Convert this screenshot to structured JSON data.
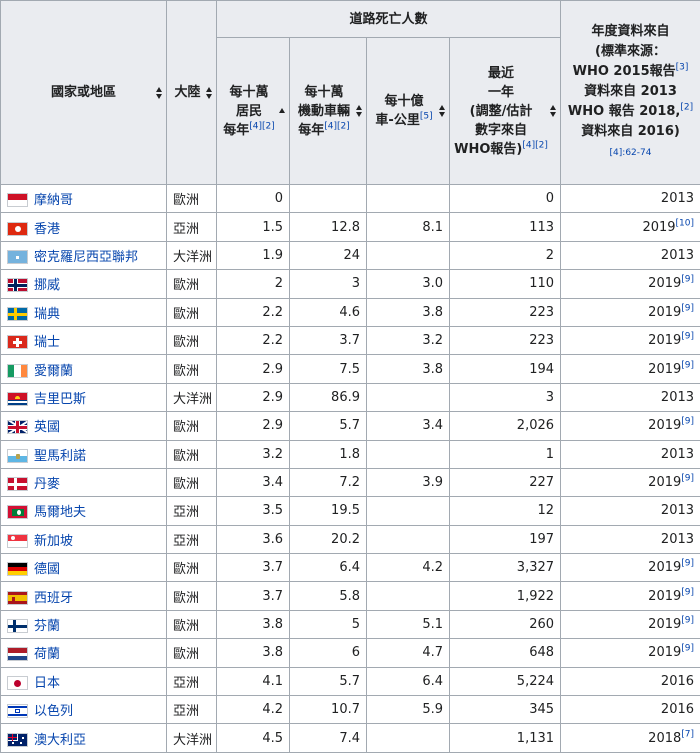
{
  "headers": {
    "country": "國家或地區",
    "continent": "大陸",
    "deaths_group": "道路死亡人數",
    "per_100k": [
      "每十萬",
      "居民",
      "每年"
    ],
    "per_100k_ref": "[4][2]",
    "per_100k_vehicles": [
      "每十萬",
      "機動車輛",
      "每年"
    ],
    "per_100k_vehicles_ref": "[4][2]",
    "per_billion_km": [
      "每十億",
      "車-公里"
    ],
    "per_billion_km_ref": "[5]",
    "recent_year": [
      "最近",
      "一年",
      "(調整/估計",
      "數字來自",
      "WHO報告)"
    ],
    "recent_year_ref": "[4][2]",
    "source_year": [
      "年度資料來自",
      "(標準來源：",
      "WHO 2015報告",
      "資料來自 2013",
      "WHO 報告 2018,",
      "資料來自 2016)"
    ],
    "source_ref_a": "[3]",
    "source_ref_b": "[2]",
    "source_note": "[4]:62-74"
  },
  "rows": [
    {
      "flag": "monaco-flag",
      "country": "摩納哥",
      "continent": "歐洲",
      "per_100k": "0",
      "per_vehicles": "",
      "per_km": "",
      "recent": "0",
      "year": "2013",
      "ref": ""
    },
    {
      "flag": "hong-kong-flag",
      "country": "香港",
      "continent": "亞洲",
      "per_100k": "1.5",
      "per_vehicles": "12.8",
      "per_km": "8.1",
      "recent": "113",
      "year": "2019",
      "ref": "[10]"
    },
    {
      "flag": "micronesia-flag",
      "country": "密克羅尼西亞聯邦",
      "continent": "大洋洲",
      "per_100k": "1.9",
      "per_vehicles": "24",
      "per_km": "",
      "recent": "2",
      "year": "2013",
      "ref": ""
    },
    {
      "flag": "norway-flag",
      "country": "挪威",
      "continent": "歐洲",
      "per_100k": "2",
      "per_vehicles": "3",
      "per_km": "3.0",
      "recent": "110",
      "year": "2019",
      "ref": "[9]"
    },
    {
      "flag": "sweden-flag",
      "country": "瑞典",
      "continent": "歐洲",
      "per_100k": "2.2",
      "per_vehicles": "4.6",
      "per_km": "3.8",
      "recent": "223",
      "year": "2019",
      "ref": "[9]"
    },
    {
      "flag": "switzerland-flag",
      "country": "瑞士",
      "continent": "歐洲",
      "per_100k": "2.2",
      "per_vehicles": "3.7",
      "per_km": "3.2",
      "recent": "223",
      "year": "2019",
      "ref": "[9]"
    },
    {
      "flag": "ireland-flag",
      "country": "愛爾蘭",
      "continent": "歐洲",
      "per_100k": "2.9",
      "per_vehicles": "7.5",
      "per_km": "3.8",
      "recent": "194",
      "year": "2019",
      "ref": "[9]"
    },
    {
      "flag": "kiribati-flag",
      "country": "吉里巴斯",
      "continent": "大洋洲",
      "per_100k": "2.9",
      "per_vehicles": "86.9",
      "per_km": "",
      "recent": "3",
      "year": "2013",
      "ref": ""
    },
    {
      "flag": "uk-flag",
      "country": "英國",
      "continent": "歐洲",
      "per_100k": "2.9",
      "per_vehicles": "5.7",
      "per_km": "3.4",
      "recent": "2,026",
      "year": "2019",
      "ref": "[9]"
    },
    {
      "flag": "san-marino-flag",
      "country": "聖馬利諾",
      "continent": "歐洲",
      "per_100k": "3.2",
      "per_vehicles": "1.8",
      "per_km": "",
      "recent": "1",
      "year": "2013",
      "ref": ""
    },
    {
      "flag": "denmark-flag",
      "country": "丹麥",
      "continent": "歐洲",
      "per_100k": "3.4",
      "per_vehicles": "7.2",
      "per_km": "3.9",
      "recent": "227",
      "year": "2019",
      "ref": "[9]"
    },
    {
      "flag": "maldives-flag",
      "country": "馬爾地夫",
      "continent": "亞洲",
      "per_100k": "3.5",
      "per_vehicles": "19.5",
      "per_km": "",
      "recent": "12",
      "year": "2013",
      "ref": ""
    },
    {
      "flag": "singapore-flag",
      "country": "新加坡",
      "continent": "亞洲",
      "per_100k": "3.6",
      "per_vehicles": "20.2",
      "per_km": "",
      "recent": "197",
      "year": "2013",
      "ref": ""
    },
    {
      "flag": "germany-flag",
      "country": "德國",
      "continent": "歐洲",
      "per_100k": "3.7",
      "per_vehicles": "6.4",
      "per_km": "4.2",
      "recent": "3,327",
      "year": "2019",
      "ref": "[9]"
    },
    {
      "flag": "spain-flag",
      "country": "西班牙",
      "continent": "歐洲",
      "per_100k": "3.7",
      "per_vehicles": "5.8",
      "per_km": "",
      "recent": "1,922",
      "year": "2019",
      "ref": "[9]"
    },
    {
      "flag": "finland-flag",
      "country": "芬蘭",
      "continent": "歐洲",
      "per_100k": "3.8",
      "per_vehicles": "5",
      "per_km": "5.1",
      "recent": "260",
      "year": "2019",
      "ref": "[9]"
    },
    {
      "flag": "netherlands-flag",
      "country": "荷蘭",
      "continent": "歐洲",
      "per_100k": "3.8",
      "per_vehicles": "6",
      "per_km": "4.7",
      "recent": "648",
      "year": "2019",
      "ref": "[9]"
    },
    {
      "flag": "japan-flag",
      "country": "日本",
      "continent": "亞洲",
      "per_100k": "4.1",
      "per_vehicles": "5.7",
      "per_km": "6.4",
      "recent": "5,224",
      "year": "2016",
      "ref": ""
    },
    {
      "flag": "israel-flag",
      "country": "以色列",
      "continent": "亞洲",
      "per_100k": "4.2",
      "per_vehicles": "10.7",
      "per_km": "5.9",
      "recent": "345",
      "year": "2016",
      "ref": ""
    },
    {
      "flag": "australia-flag",
      "country": "澳大利亞",
      "continent": "大洋洲",
      "per_100k": "4.5",
      "per_vehicles": "7.4",
      "per_km": "",
      "recent": "1,131",
      "year": "2018",
      "ref": "[7]"
    }
  ]
}
